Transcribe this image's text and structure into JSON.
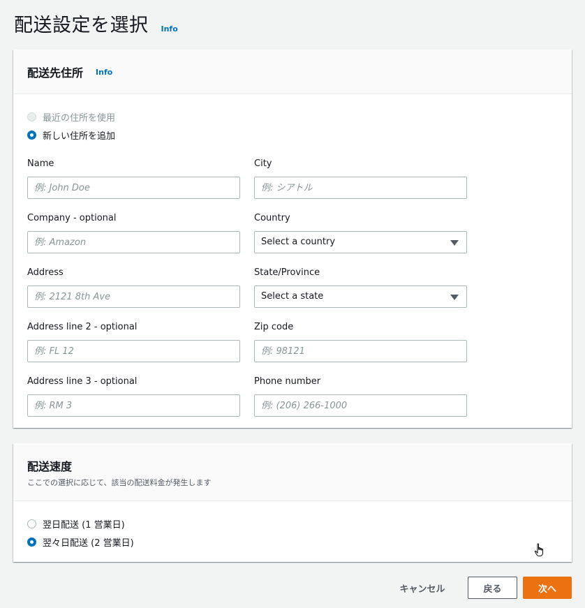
{
  "page": {
    "title": "配送設定を選択",
    "info_label": "Info"
  },
  "address_panel": {
    "title": "配送先住所",
    "info_label": "Info",
    "options": [
      {
        "label": "最近の住所を使用",
        "selected": false,
        "disabled": true
      },
      {
        "label": "新しい住所を追加",
        "selected": true,
        "disabled": false
      }
    ],
    "fields": {
      "name": {
        "label": "Name",
        "placeholder": "例: John Doe",
        "value": ""
      },
      "company": {
        "label": "Company - optional",
        "placeholder": "例: Amazon",
        "value": ""
      },
      "address": {
        "label": "Address",
        "placeholder": "例: 2121 8th Ave",
        "value": ""
      },
      "address2": {
        "label": "Address line 2 - optional",
        "placeholder": "例: FL 12",
        "value": ""
      },
      "address3": {
        "label": "Address line 3 - optional",
        "placeholder": "例: RM 3",
        "value": ""
      },
      "city": {
        "label": "City",
        "placeholder": "例: シアトル",
        "value": ""
      },
      "country": {
        "label": "Country",
        "selected": "Select a country"
      },
      "state": {
        "label": "State/Province",
        "selected": "Select a state"
      },
      "zip": {
        "label": "Zip code",
        "placeholder": "例: 98121",
        "value": ""
      },
      "phone": {
        "label": "Phone number",
        "placeholder": "例: (206) 266-1000",
        "value": ""
      }
    }
  },
  "speed_panel": {
    "title": "配送速度",
    "description": "ここでの選択に応じて、該当の配送料金が発生します",
    "options": [
      {
        "label": "翌日配送 (1 営業日)",
        "selected": false
      },
      {
        "label": "翌々日配送 (2 営業日)",
        "selected": true
      }
    ]
  },
  "actions": {
    "cancel": "キャンセル",
    "back": "戻る",
    "next": "次へ"
  },
  "colors": {
    "accent": "#0073bb",
    "primary_button": "#ec7211",
    "background": "#f2f3f3"
  },
  "icons": {
    "select_arrow": "caret-down-icon",
    "cursor": "hand-pointer-icon"
  }
}
